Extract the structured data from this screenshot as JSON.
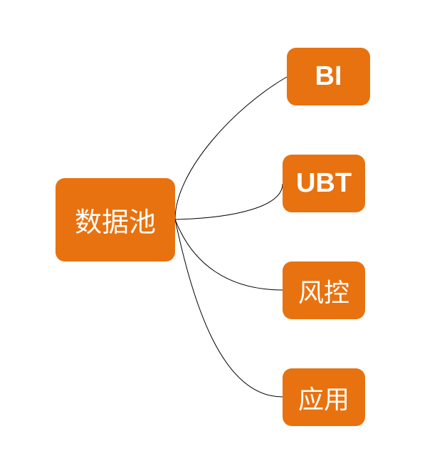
{
  "diagram": {
    "root": {
      "label": "数据池"
    },
    "children": [
      {
        "label": "BI"
      },
      {
        "label": "UBT"
      },
      {
        "label": "风控"
      },
      {
        "label": "应用"
      }
    ],
    "node_color": "#E8720F",
    "text_color": "#FFFFFF",
    "line_color": "#000000"
  }
}
